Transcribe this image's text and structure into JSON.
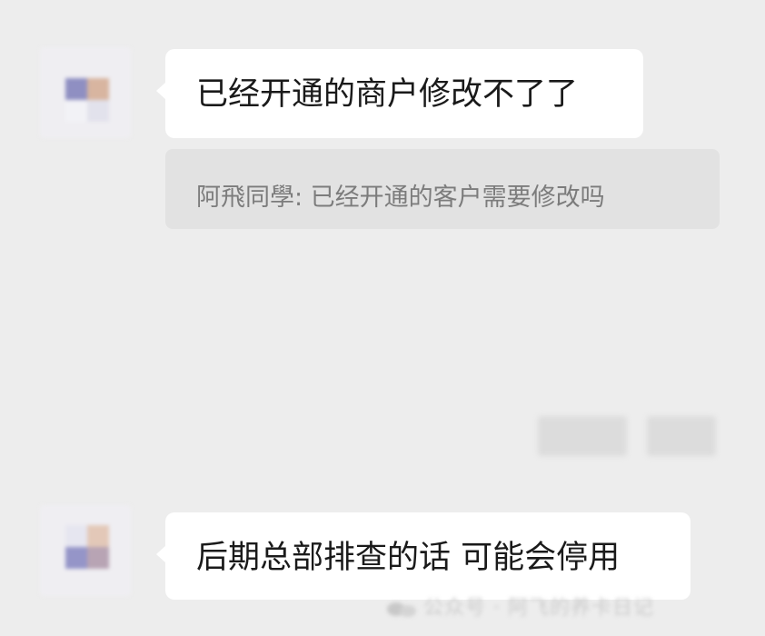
{
  "messages": [
    {
      "text": "已经开通的商户修改不了了",
      "quote": "阿飛同學: 已经开通的客户需要修改吗"
    },
    {
      "text": "后期总部排查的话 可能会停用"
    }
  ],
  "watermark": "公众号 · 阿飞的养卡日记",
  "colors": {
    "background": "#ededed",
    "bubble": "#ffffff",
    "quote_bg": "#e2e2e2",
    "quote_text": "#7c7c7c"
  }
}
